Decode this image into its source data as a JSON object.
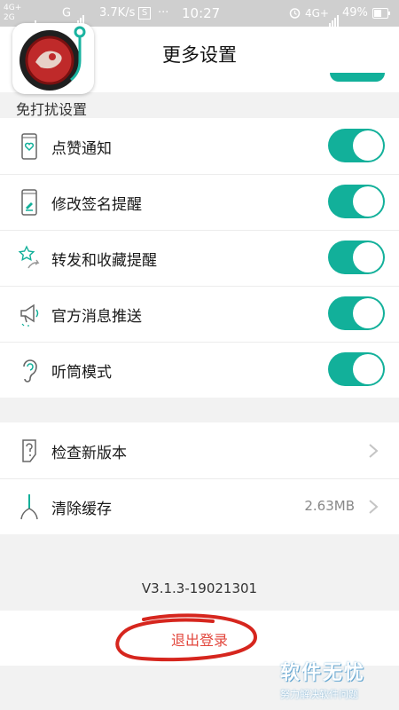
{
  "status_bar": {
    "network_left": "4G+",
    "network_left_2": "2G",
    "carrier_g": "G",
    "speed": "3.7K/s",
    "s_badge": "S",
    "time": "10:27",
    "network_right": "4G+",
    "battery": "49%"
  },
  "header": {
    "title": "更多设置"
  },
  "app_icon": {
    "name": "app-logo-icon"
  },
  "dnd": {
    "section_label": "免打扰设置",
    "items": [
      {
        "label": "点赞通知",
        "icon": "phone-heart-icon",
        "on": true
      },
      {
        "label": "修改签名提醒",
        "icon": "phone-edit-icon",
        "on": true
      },
      {
        "label": "转发和收藏提醒",
        "icon": "star-share-icon",
        "on": true
      },
      {
        "label": "官方消息推送",
        "icon": "megaphone-icon",
        "on": true
      },
      {
        "label": "听筒模式",
        "icon": "ear-icon",
        "on": true
      }
    ]
  },
  "misc": {
    "items": [
      {
        "label": "检查新版本",
        "icon": "question-icon",
        "value": ""
      },
      {
        "label": "清除缓存",
        "icon": "broom-icon",
        "value": "2.63MB"
      }
    ]
  },
  "version": "V3.1.3-19021301",
  "logout_label": "退出登录",
  "watermark": {
    "title": "软件无忧",
    "subtitle": "努力解决软件问题"
  },
  "colors": {
    "accent": "#12b09a",
    "danger": "#e2463c",
    "annotation": "#d6261e"
  }
}
